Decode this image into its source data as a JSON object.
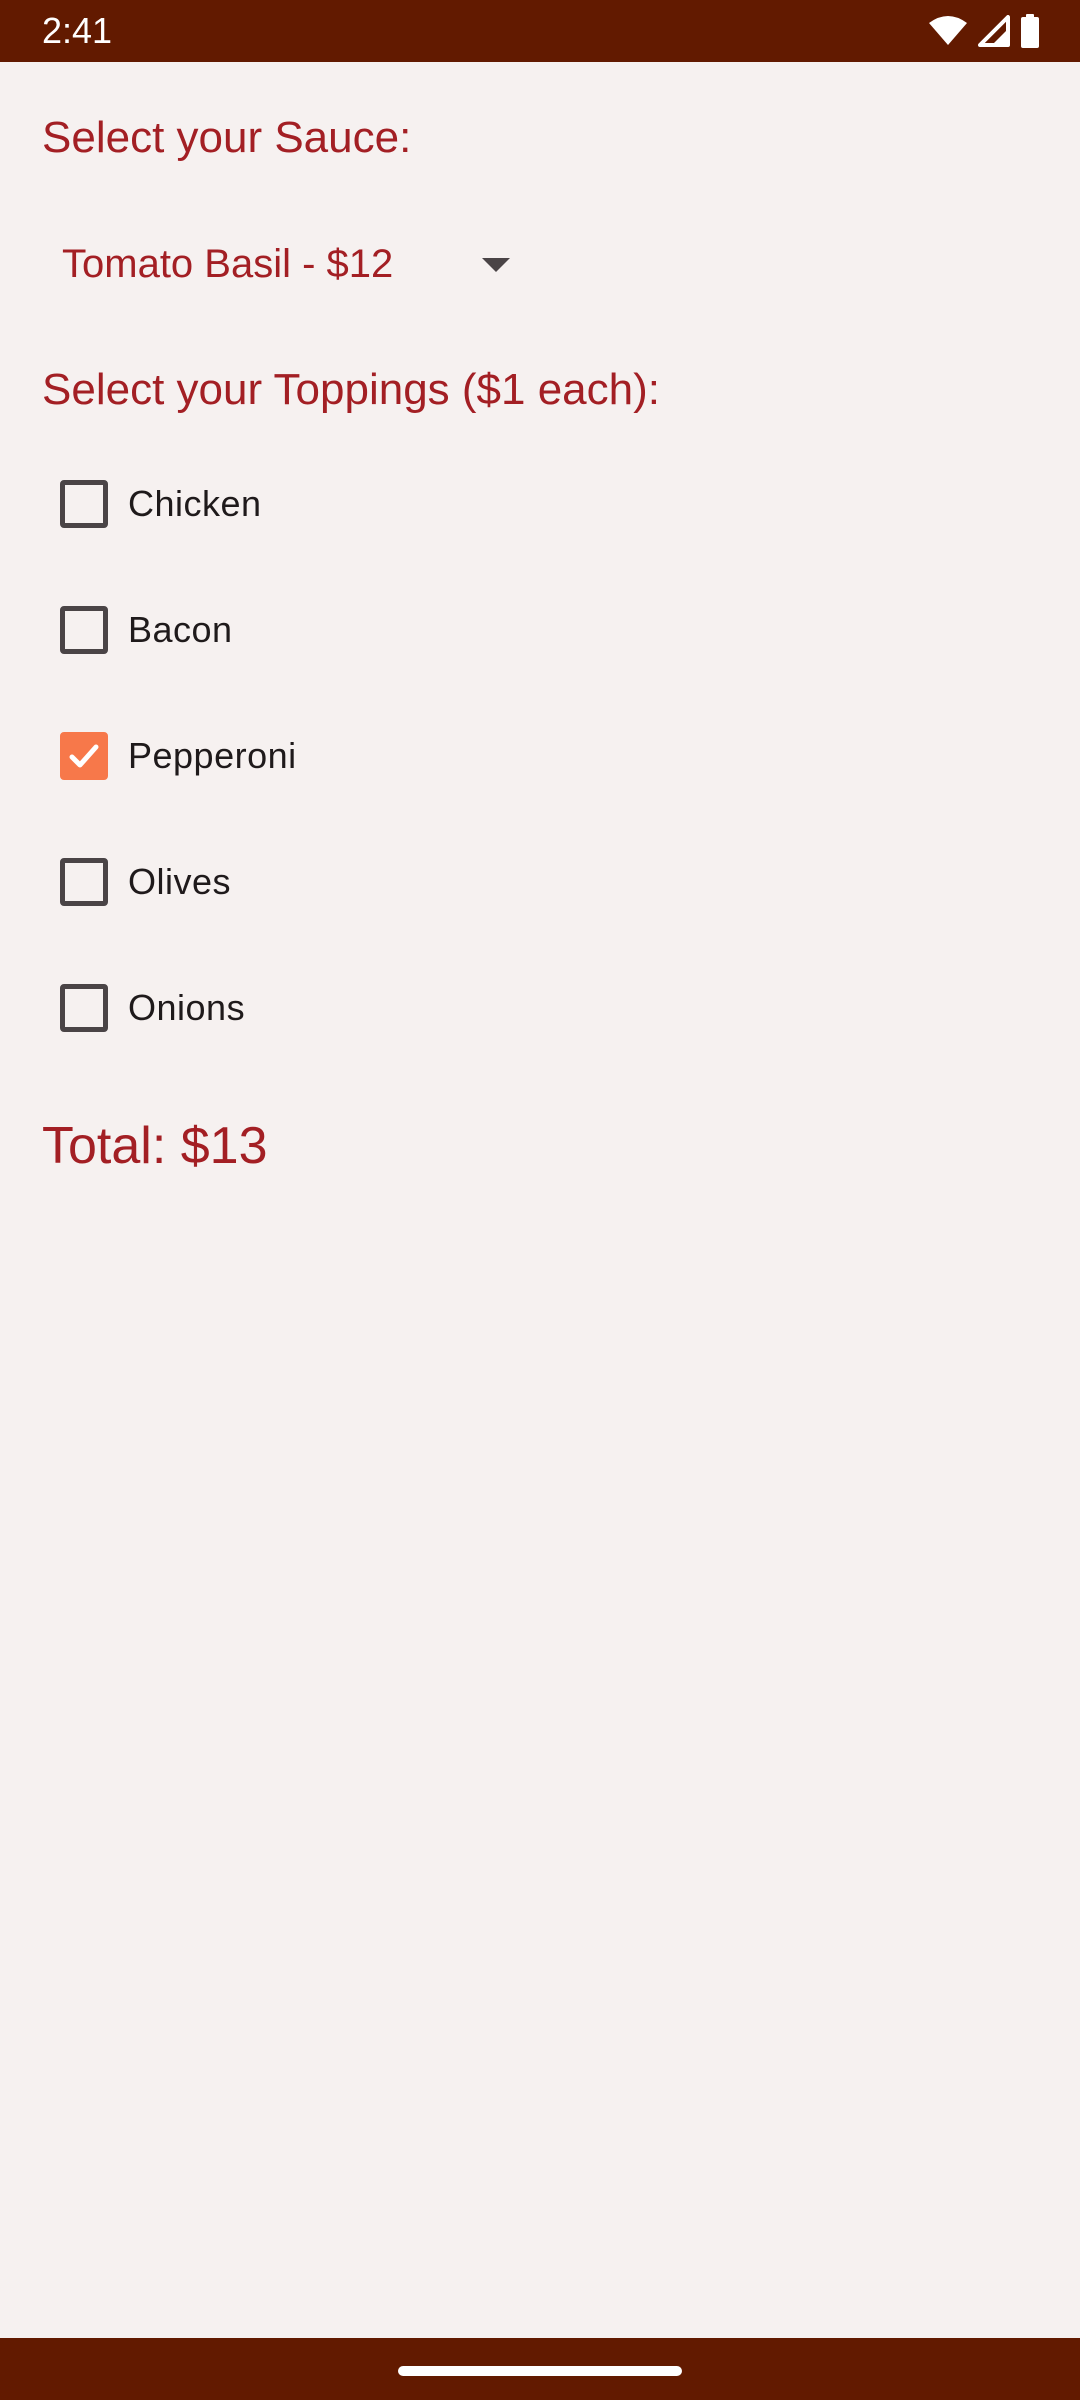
{
  "status_bar": {
    "time": "2:41",
    "icons": [
      "wifi-icon",
      "signal-icon",
      "battery-icon"
    ]
  },
  "sauce_section": {
    "title": "Select your Sauce:",
    "selected_value": "Tomato Basil - $12"
  },
  "toppings_section": {
    "title": "Select your Toppings ($1 each):",
    "items": [
      {
        "label": "Chicken",
        "checked": false
      },
      {
        "label": "Bacon",
        "checked": false
      },
      {
        "label": "Pepperoni",
        "checked": true
      },
      {
        "label": "Olives",
        "checked": false
      },
      {
        "label": "Onions",
        "checked": false
      }
    ]
  },
  "total": {
    "text": "Total: $13"
  },
  "colors": {
    "system_bar": "#621a00",
    "accent_text": "#a31f24",
    "checkbox_checked": "#f7784a",
    "background": "#f6f1f0"
  }
}
